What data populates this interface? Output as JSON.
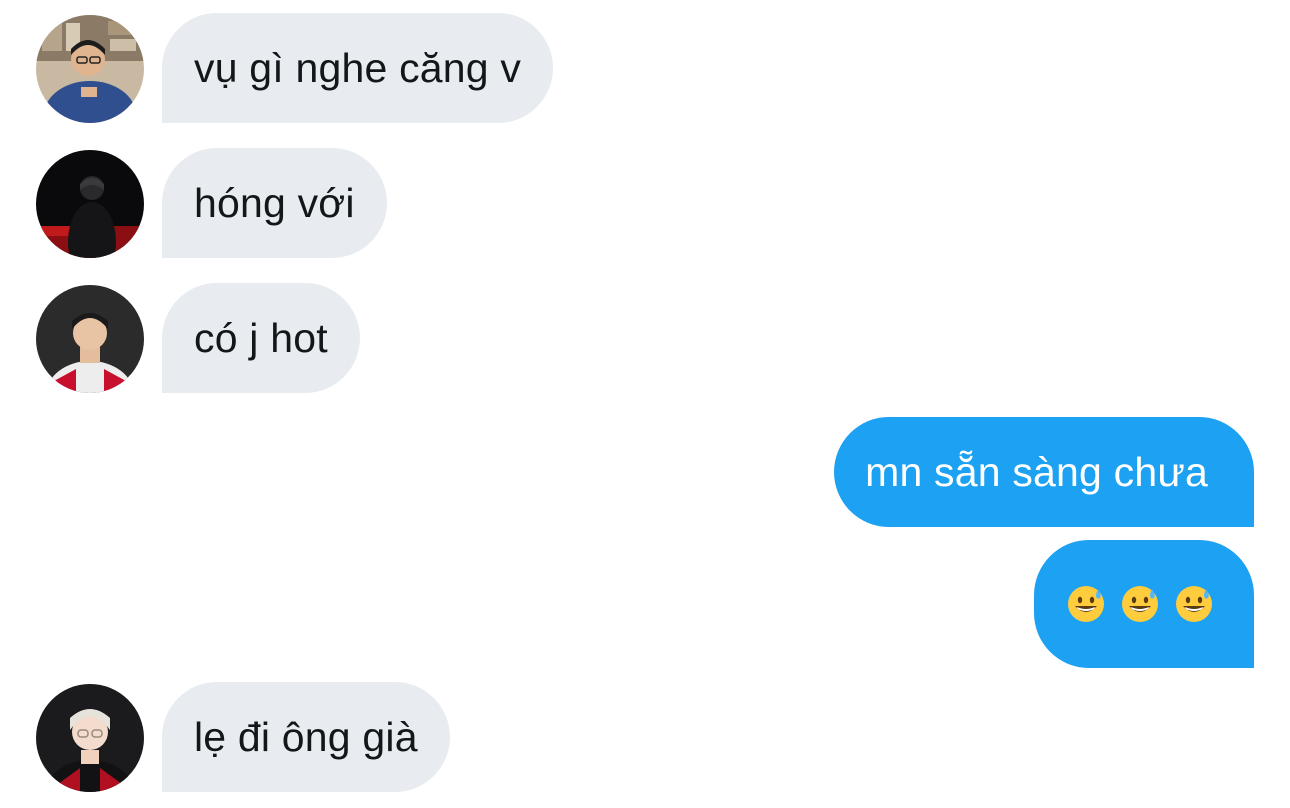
{
  "conversation": {
    "messages": [
      {
        "direction": "incoming",
        "text": "vụ gì nghe căng v",
        "avatar": "avatar-glasses-man-bookshelf"
      },
      {
        "direction": "incoming",
        "text": "hóng với",
        "avatar": "avatar-dark-figure-red-stage"
      },
      {
        "direction": "incoming",
        "text": "có j hot",
        "avatar": "avatar-player-hle-jersey"
      },
      {
        "direction": "outgoing",
        "text": "mn sẵn sàng chưa"
      },
      {
        "direction": "outgoing",
        "emoji": [
          "grinning-face-with-sweat",
          "grinning-face-with-sweat",
          "grinning-face-with-sweat"
        ]
      },
      {
        "direction": "incoming",
        "text": "lẹ đi ông già",
        "avatar": "avatar-blond-glasses-player"
      }
    ]
  },
  "colors": {
    "incoming_bubble": "#e8ecf0",
    "incoming_text": "#14171a",
    "outgoing_bubble": "#1da1f2",
    "outgoing_text": "#ffffff",
    "background": "#ffffff"
  }
}
